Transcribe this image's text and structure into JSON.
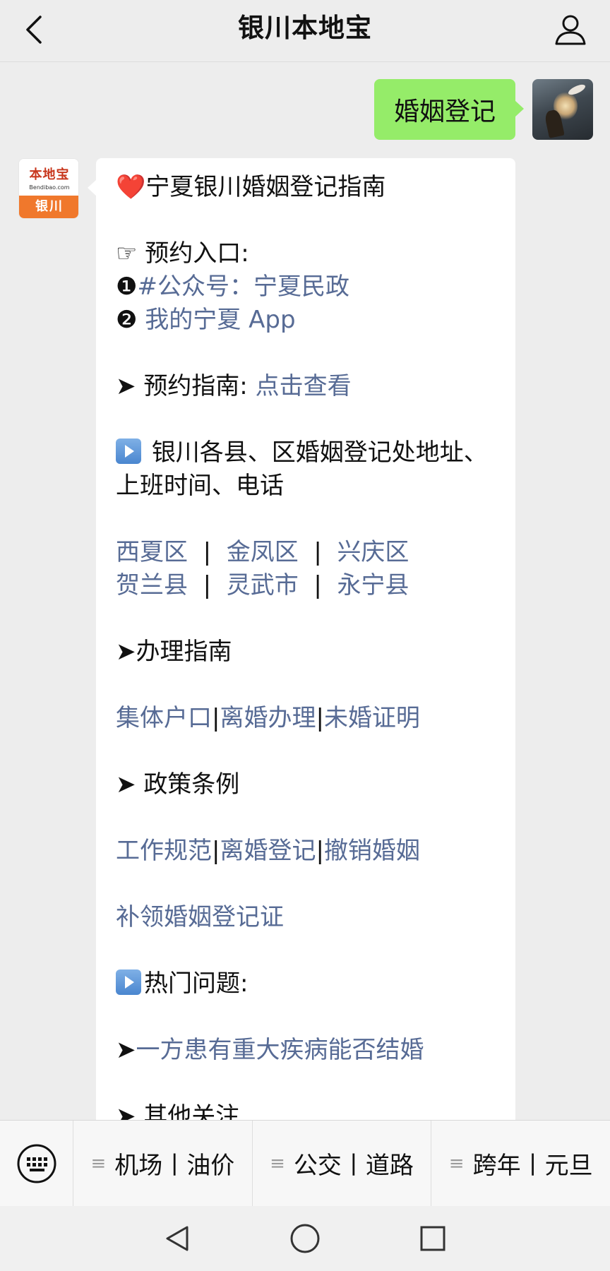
{
  "header": {
    "title": "银川本地宝",
    "back_icon": "chevron-left-icon",
    "profile_icon": "person-icon"
  },
  "chat": {
    "sent_message": "婚姻登记",
    "bot_avatar": {
      "logo_text": "本地宝",
      "logo_subtext": "Bendibao.com",
      "city": "银川"
    },
    "reply": {
      "title_heart": "❤️",
      "title": "宁夏银川婚姻登记指南",
      "booking_label": "☞ 预约入口:",
      "booking_1_num": "❶",
      "booking_1": "#公众号：宁夏民政",
      "booking_2_num": "❷",
      "booking_2": "我的宁夏 App",
      "guide_arrow": "➤",
      "guide_label": "预约指南:",
      "guide_link": "点击查看",
      "offices_line1": "银川各县、区婚姻登记处地址、",
      "offices_line2": "上班时间、电话",
      "districts": [
        "西夏区",
        "金凤区",
        "兴庆区",
        "贺兰县",
        "灵武市",
        "永宁县"
      ],
      "separator": "|",
      "handling_label": "办理指南",
      "handling_links": [
        "集体户口",
        "离婚办理",
        "未婚证明"
      ],
      "policy_label": "政策条例",
      "policy_links": [
        "工作规范",
        "离婚登记",
        "撤销婚姻"
      ],
      "reissue_link": "补领婚姻登记证",
      "faq_label": "热门问题:",
      "faq_1": "一方患有重大疾病能否结婚",
      "cut_label": "其他关注"
    }
  },
  "menubar": {
    "keyboard_icon": "keyboard-icon",
    "items": [
      {
        "a": "机场",
        "b": "油价"
      },
      {
        "a": "公交",
        "b": "道路"
      },
      {
        "a": "跨年",
        "b": "元旦"
      }
    ],
    "item_icon": "≡",
    "divider": "丨"
  },
  "navbar": {
    "back": "back-triangle-icon",
    "home": "home-circle-icon",
    "recents": "recents-square-icon"
  }
}
